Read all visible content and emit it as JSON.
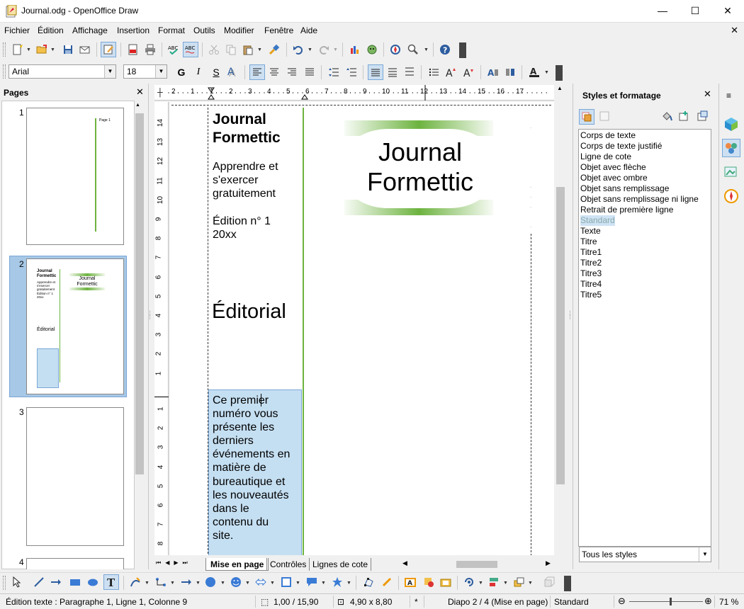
{
  "window": {
    "title": "Journal.odg - OpenOffice Draw",
    "minimize": "—",
    "maximize": "☐",
    "close": "✕"
  },
  "menu": {
    "items": [
      "Fichier",
      "Édition",
      "Affichage",
      "Insertion",
      "Format",
      "Outils",
      "Modifier",
      "Fenêtre",
      "Aide"
    ],
    "doc_close": "✕"
  },
  "formatting": {
    "font_name": "Arial",
    "font_size": "18",
    "bold": "G",
    "italic": "I",
    "underline": "S"
  },
  "pages_panel": {
    "title": "Pages",
    "close": "✕",
    "pages": [
      {
        "number": "1",
        "mini_text": "Page 1"
      },
      {
        "number": "2",
        "mini_title": "Journal Formettic",
        "mini_sub": "Apprendre et s'exercer gratuitement",
        "mini_ed": "Édition n° 1 20xx",
        "mini_logo1": "Journal",
        "mini_logo2": "Formettic",
        "mini_editorial": "Éditorial"
      },
      {
        "number": "3"
      },
      {
        "number": "4"
      }
    ]
  },
  "ruler": {
    "h_ticks": [
      "2",
      "1",
      "1",
      "2",
      "3",
      "4",
      "5",
      "6",
      "7",
      "8",
      "9",
      "10",
      "11",
      "12",
      "13",
      "14",
      "15",
      "16",
      "17"
    ],
    "v_ticks_top": [
      "14",
      "13",
      "12",
      "11",
      "10",
      "9",
      "8",
      "7",
      "6",
      "5",
      "4",
      "3",
      "2",
      "1"
    ],
    "v_ticks_bottom": [
      "1",
      "2",
      "3",
      "4",
      "5",
      "6",
      "7",
      "8"
    ]
  },
  "document": {
    "left_title_line1": "Journal",
    "left_title_line2": "Formettic",
    "subtitle": [
      "Apprendre et",
      "s'exercer",
      "gratuitement"
    ],
    "edition": [
      "Édition n° 1",
      "20xx"
    ],
    "logo_line1": "Journal",
    "logo_line2": "Formettic",
    "editorial": "Éditorial",
    "editorial_text": [
      "Ce premier",
      "numéro vous",
      "présente les",
      "derniers",
      "événements en",
      "matière de",
      "bureautique et",
      "les nouveautés",
      "dans le",
      "contenu du",
      "site."
    ]
  },
  "tabs": {
    "items": [
      "Mise en page",
      "Contrôles",
      "Lignes de cote"
    ],
    "active": "Mise en page"
  },
  "styles_panel": {
    "title": "Styles et formatage",
    "close": "✕",
    "items": [
      "Corps de texte",
      "Corps de texte justifié",
      "Ligne de cote",
      "Objet avec flèche",
      "Objet avec ombre",
      "Objet sans remplissage",
      "Objet sans remplissage ni ligne",
      "Retrait de première ligne",
      "Standard",
      "Texte",
      "Titre",
      "Titre1",
      "Titre2",
      "Titre3",
      "Titre4",
      "Titre5"
    ],
    "selected": "Standard",
    "filter": "Tous les styles"
  },
  "status": {
    "edit_info": "Édition texte : Paragraphe 1, Ligne 1, Colonne 9",
    "position": "1,00 / 15,90",
    "size": "4,90 x 8,80",
    "modified": "*",
    "slide": "Diapo 2 / 4 (Mise en page)",
    "layout": "Standard",
    "zoom": "71 %",
    "zoom_fraction": 0.55
  },
  "colors": {
    "accent_green": "#6db33f",
    "selection_blue": "#c5dff2",
    "title_blue": "#1b6ec2"
  }
}
